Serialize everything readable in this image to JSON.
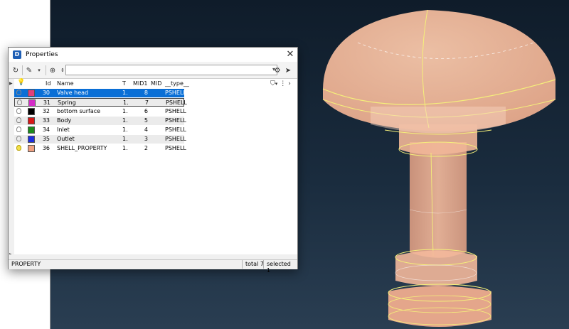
{
  "dialog": {
    "title": "Properties",
    "close_icon": "close-icon"
  },
  "toolbar": {
    "search_value": "",
    "icons": [
      "refresh-icon",
      "brush-icon",
      "zoom-icon",
      "search-icon",
      "settings-icon",
      "pointer-icon"
    ]
  },
  "table": {
    "columns": {
      "id": "Id",
      "name": "Name",
      "t": "T",
      "mid1": "MID1",
      "mid": "MID",
      "type": "__type__"
    },
    "rows": [
      {
        "id": "30",
        "name": "Valve head",
        "t": "1.",
        "mid1": "8",
        "type": "PSHELL",
        "color": "#e0407a",
        "bulb_on": false,
        "selected": true
      },
      {
        "id": "31",
        "name": "Spring",
        "t": "1.",
        "mid1": "7",
        "type": "PSHELL",
        "color": "#d42cc8",
        "bulb_on": false,
        "selected": false
      },
      {
        "id": "32",
        "name": "bottom surface",
        "t": "1.",
        "mid1": "6",
        "type": "PSHELL",
        "color": "#000000",
        "bulb_on": false,
        "selected": false
      },
      {
        "id": "33",
        "name": "Body",
        "t": "1.",
        "mid1": "5",
        "type": "PSHELL",
        "color": "#d81818",
        "bulb_on": false,
        "selected": false
      },
      {
        "id": "34",
        "name": "Inlet",
        "t": "1.",
        "mid1": "4",
        "type": "PSHELL",
        "color": "#1c8a1c",
        "bulb_on": false,
        "selected": false
      },
      {
        "id": "35",
        "name": "Outlet",
        "t": "1.",
        "mid1": "3",
        "type": "PSHELL",
        "color": "#1c2ee0",
        "bulb_on": false,
        "selected": false
      },
      {
        "id": "36",
        "name": "SHELL_PROPERTY",
        "t": "1.",
        "mid1": "2",
        "type": "PSHELL",
        "color": "#f0a080",
        "bulb_on": true,
        "selected": false
      }
    ]
  },
  "status": {
    "entity": "PROPERTY",
    "total": "total 7",
    "selected": "selected 1"
  },
  "viewport": {
    "model": "valve",
    "shell_color": "#f4b89a",
    "edge_color": "#f5f07a"
  }
}
